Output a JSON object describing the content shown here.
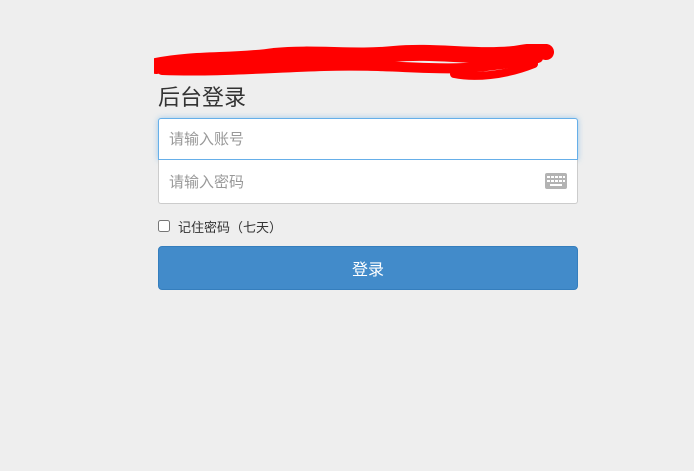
{
  "form": {
    "subtitle": "后台登录",
    "username_placeholder": "请输入账号",
    "password_placeholder": "请输入密码",
    "remember_label": "记住密码（七天）",
    "submit_label": "登录"
  },
  "colors": {
    "redaction": "#ff0000",
    "button": "#428bca",
    "focus_border": "#66afe9"
  },
  "icons": {
    "keyboard": "keyboard-icon"
  }
}
